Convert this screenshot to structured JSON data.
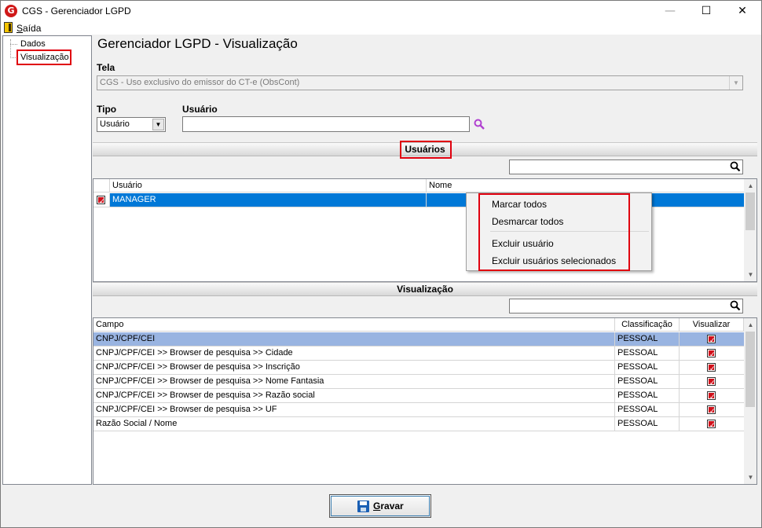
{
  "window": {
    "title": "CGS - Gerenciador LGPD",
    "logo_letter": "G",
    "minimize": "—",
    "maximize": "☐",
    "close": "✕"
  },
  "menu": {
    "exit_first": "S",
    "exit_rest": "aída"
  },
  "tree": {
    "items": [
      {
        "label": "Dados"
      },
      {
        "label": "Visualização",
        "selected": true
      }
    ]
  },
  "page": {
    "title": "Gerenciador LGPD - Visualização"
  },
  "form": {
    "screen_label": "Tela",
    "screen_value": "CGS - Uso exclusivo do emissor do CT-e (ObsCont)",
    "type_label": "Tipo",
    "type_value": "Usuário",
    "user_label": "Usuário",
    "user_value": ""
  },
  "users_section": {
    "title": "Usuários",
    "search_value": "",
    "columns": [
      "Usuário",
      "Nome"
    ],
    "rows": [
      {
        "checked": true,
        "user": "MANAGER",
        "name": ""
      }
    ]
  },
  "context_menu": {
    "items": [
      "Marcar todos",
      "Desmarcar todos",
      "Excluir usuário",
      "Excluir usuários selecionados"
    ]
  },
  "view_section": {
    "title": "Visualização",
    "search_value": "",
    "columns": [
      "Campo",
      "Classificação",
      "Visualizar"
    ],
    "rows": [
      {
        "field": "CNPJ/CPF/CEI",
        "class": "PESSOAL",
        "view": true
      },
      {
        "field": "CNPJ/CPF/CEI >> Browser de pesquisa >> Cidade",
        "class": "PESSOAL",
        "view": true
      },
      {
        "field": "CNPJ/CPF/CEI >> Browser de pesquisa >> Inscrição",
        "class": "PESSOAL",
        "view": true
      },
      {
        "field": "CNPJ/CPF/CEI >> Browser de pesquisa >> Nome Fantasia",
        "class": "PESSOAL",
        "view": true
      },
      {
        "field": "CNPJ/CPF/CEI >> Browser de pesquisa >> Razão social",
        "class": "PESSOAL",
        "view": true
      },
      {
        "field": "CNPJ/CPF/CEI >> Browser de pesquisa >> UF",
        "class": "PESSOAL",
        "view": true
      },
      {
        "field": "Razão Social / Nome",
        "class": "PESSOAL",
        "view": true
      }
    ]
  },
  "save_button": {
    "first": "G",
    "rest": "ravar"
  },
  "colors": {
    "highlight_red": "#e0000f",
    "selected_row": "#0078d7",
    "selected_row_view": "#99b4e1",
    "checkbox_red": "#d0101a"
  }
}
